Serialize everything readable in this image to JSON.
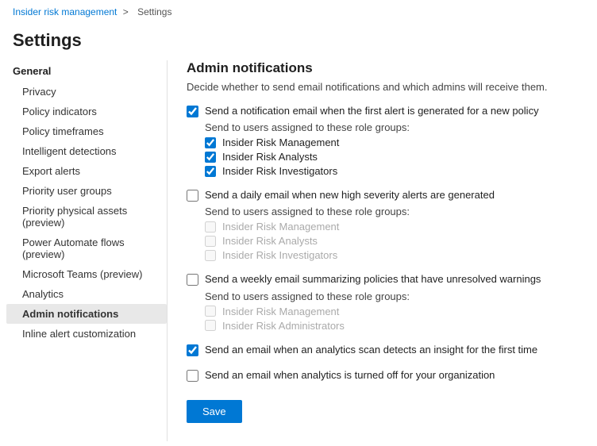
{
  "breadcrumb": {
    "part1": "Insider risk management",
    "separator": ">",
    "part2": "Settings"
  },
  "pageTitle": "Settings",
  "sidebar": {
    "generalLabel": "General",
    "items": [
      {
        "label": "Privacy",
        "id": "privacy",
        "active": false
      },
      {
        "label": "Policy indicators",
        "id": "policy-indicators",
        "active": false
      },
      {
        "label": "Policy timeframes",
        "id": "policy-timeframes",
        "active": false
      },
      {
        "label": "Intelligent detections",
        "id": "intelligent-detections",
        "active": false
      },
      {
        "label": "Export alerts",
        "id": "export-alerts",
        "active": false
      },
      {
        "label": "Priority user groups",
        "id": "priority-user-groups",
        "active": false
      },
      {
        "label": "Priority physical assets (preview)",
        "id": "priority-physical-assets",
        "active": false
      },
      {
        "label": "Power Automate flows (preview)",
        "id": "power-automate-flows",
        "active": false
      },
      {
        "label": "Microsoft Teams (preview)",
        "id": "microsoft-teams",
        "active": false
      },
      {
        "label": "Analytics",
        "id": "analytics",
        "active": false
      },
      {
        "label": "Admin notifications",
        "id": "admin-notifications",
        "active": true
      },
      {
        "label": "Inline alert customization",
        "id": "inline-alert",
        "active": false
      }
    ]
  },
  "main": {
    "sectionTitle": "Admin notifications",
    "sectionDesc": "Decide whether to send email notifications and which admins will receive them.",
    "notifications": [
      {
        "id": "notif1",
        "checked": true,
        "label": "Send a notification email when the first alert is generated for a new policy",
        "hasSubgroup": true,
        "subgroupLabel": "Send to users assigned to these role groups:",
        "subItems": [
          {
            "label": "Insider Risk Management",
            "checked": true,
            "disabled": false
          },
          {
            "label": "Insider Risk Analysts",
            "checked": true,
            "disabled": false
          },
          {
            "label": "Insider Risk Investigators",
            "checked": true,
            "disabled": false
          }
        ]
      },
      {
        "id": "notif2",
        "checked": false,
        "label": "Send a daily email when new high severity alerts are generated",
        "hasSubgroup": true,
        "subgroupLabel": "Send to users assigned to these role groups:",
        "subItems": [
          {
            "label": "Insider Risk Management",
            "checked": false,
            "disabled": true
          },
          {
            "label": "Insider Risk Analysts",
            "checked": false,
            "disabled": true
          },
          {
            "label": "Insider Risk Investigators",
            "checked": false,
            "disabled": true
          }
        ]
      },
      {
        "id": "notif3",
        "checked": false,
        "label": "Send a weekly email summarizing policies that have unresolved warnings",
        "hasSubgroup": true,
        "subgroupLabel": "Send to users assigned to these role groups:",
        "subItems": [
          {
            "label": "Insider Risk Management",
            "checked": false,
            "disabled": true
          },
          {
            "label": "Insider Risk Administrators",
            "checked": false,
            "disabled": true
          }
        ]
      },
      {
        "id": "notif4",
        "checked": true,
        "label": "Send an email when an analytics scan detects an insight for the first time",
        "hasSubgroup": false,
        "subItems": []
      },
      {
        "id": "notif5",
        "checked": false,
        "label": "Send an email when analytics is turned off for your organization",
        "hasSubgroup": false,
        "subItems": []
      }
    ],
    "saveLabel": "Save"
  }
}
